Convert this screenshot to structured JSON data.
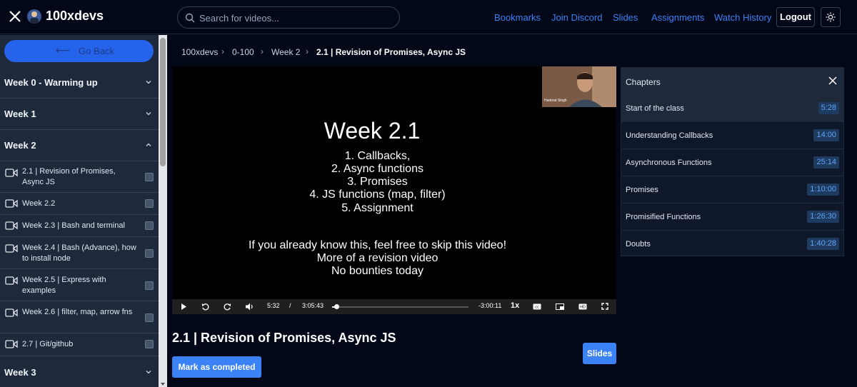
{
  "header": {
    "logo_text": "100xdevs",
    "search_placeholder": "Search for videos...",
    "nav": [
      "Bookmarks",
      "Join Discord",
      "Slides",
      "Assignments",
      "Watch History"
    ],
    "logout_label": "Logout"
  },
  "sidebar": {
    "back_label": "Go Back",
    "weeks": [
      {
        "label": "Week 0 - Warming up",
        "expanded": false
      },
      {
        "label": "Week 1",
        "expanded": false
      },
      {
        "label": "Week 2",
        "expanded": true
      },
      {
        "label": "Week 3",
        "expanded": false
      }
    ],
    "items": [
      "2.1 | Revision of Promises, Async JS",
      "Week 2.2",
      "Week 2.3 | Bash and terminal",
      "Week 2.4 | Bash (Advance), how to install node",
      "Week 2.5 | Express with examples",
      "Week 2.6 | filter, map, arrow fns",
      "2.7 | Git/github"
    ]
  },
  "breadcrumb": [
    "100xdevs",
    "0-100",
    "Week 2",
    "2.1 | Revision of Promises, Async JS"
  ],
  "video": {
    "slide": {
      "title": "Week 2.1",
      "list": [
        "1. Callbacks,",
        "2. Async functions",
        "3. Promises",
        "4. JS functions (map, filter)",
        "5. Assignment"
      ],
      "notes": [
        "If you already know this, feel free to skip this video!",
        "More of a revision video",
        "No bounties today"
      ]
    },
    "webcam_name": "Harkirat Singh",
    "current_time": "5:32",
    "separator": "/",
    "duration": "3:05:43",
    "remaining": "-3:00:11",
    "speed": "1x",
    "progress_fraction": 0.03
  },
  "content": {
    "title": "2.1 | Revision of Promises, Async JS",
    "slides_label": "Slides",
    "mark_completed_label": "Mark as completed"
  },
  "chapters": {
    "title": "Chapters",
    "items": [
      {
        "name": "Start of the class",
        "time": "5:28",
        "active": true
      },
      {
        "name": "Understanding Callbacks",
        "time": "14:00"
      },
      {
        "name": "Asynchronous Functions",
        "time": "25:14"
      },
      {
        "name": "Promises",
        "time": "1:10:00"
      },
      {
        "name": "Promisified Functions",
        "time": "1:26:30"
      },
      {
        "name": "Doubts",
        "time": "1:40:28"
      }
    ]
  },
  "colors": {
    "accent": "#3b82f6",
    "background": "#020817",
    "sidebar": "#1e293b"
  }
}
